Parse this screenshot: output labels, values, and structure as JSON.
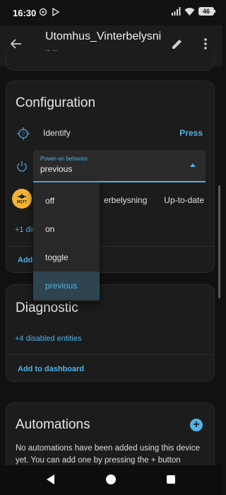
{
  "status_bar": {
    "time": "16:30",
    "battery": "46",
    "left_icons": [
      "settings-notification-icon",
      "play-store-icon"
    ],
    "right_icons": [
      "signal-icon",
      "wifi-icon",
      "battery-icon"
    ]
  },
  "app_bar": {
    "title": "Utomhus_Vinterbelysning",
    "icons": [
      "back-arrow-icon",
      "edit-pencil-icon",
      "more-vert-icon"
    ]
  },
  "configuration": {
    "title": "Configuration",
    "identify_label": "Identify",
    "identify_button": "Press",
    "select_label": "Power-on behavior",
    "select_value": "previous",
    "device_name_partial": "erbelysning",
    "device_status": "Up-to-date",
    "disabled_link_partial": "+1 dis",
    "add_link_partial": "Add",
    "mqtt_logo_text": "MQTT"
  },
  "dropdown": {
    "options": [
      "off",
      "on",
      "toggle",
      "previous"
    ],
    "selected": "previous"
  },
  "diagnostic": {
    "title": "Diagnostic",
    "disabled_entities": "+4 disabled entities",
    "add_to_dashboard": "Add to dashboard"
  },
  "automations": {
    "title": "Automations",
    "text": "No automations have been added using this device yet. You can add one by pressing the + button",
    "add_button": "+"
  },
  "colors": {
    "accent": "#4fb3e8",
    "background": "#111111",
    "card": "#1c1c1c",
    "menu_selected": "#2e4450",
    "mqtt_logo": "#f5b335"
  }
}
